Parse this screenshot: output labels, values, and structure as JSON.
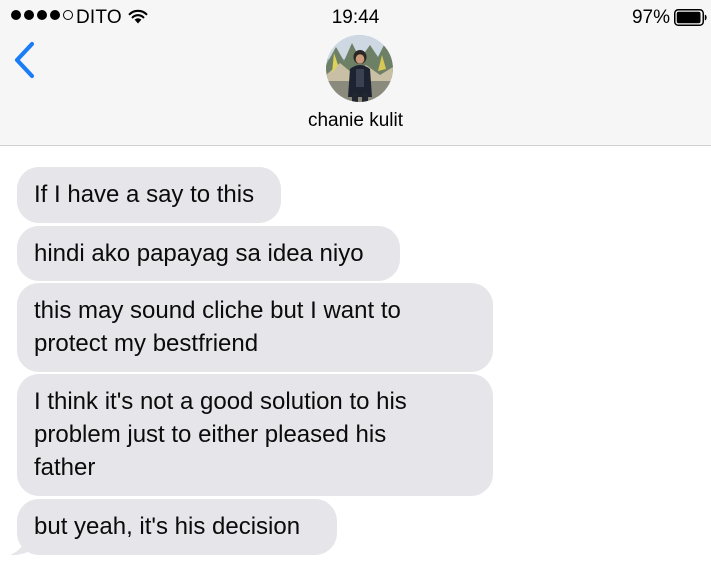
{
  "status_bar": {
    "signal_filled": 4,
    "signal_total": 5,
    "carrier": "DITO",
    "time": "19:44",
    "battery_percent": "97%",
    "battery_level": 0.97,
    "wifi_icon": "wifi-icon",
    "battery_icon": "battery-icon"
  },
  "header": {
    "back_icon": "chevron-left-icon",
    "contact_name": "chanie kulit",
    "accent_color": "#1a7cf6",
    "background_color": "#f6f6f7"
  },
  "messages": [
    {
      "lines": [
        "If I have a say to this"
      ]
    },
    {
      "lines": [
        "hindi ako papayag sa idea niyo"
      ]
    },
    {
      "lines": [
        "this may sound cliche but I want to",
        "protect my bestfriend"
      ]
    },
    {
      "lines": [
        "I think it's not a good solution to his",
        "problem just to either pleased his",
        "father"
      ]
    },
    {
      "lines": [
        "but yeah, it's his decision"
      ]
    }
  ],
  "bubble_color": "#e5e5ea"
}
